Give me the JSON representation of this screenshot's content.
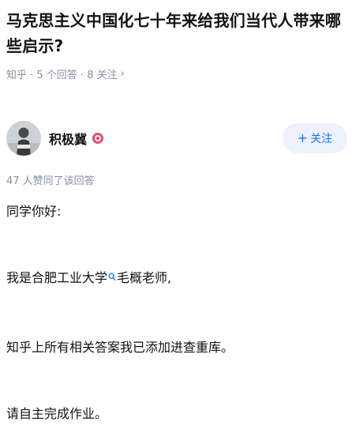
{
  "question": {
    "title": "马克思主义中国化七十年来给我们当代人带来哪些启示?",
    "meta": "知乎 · 5 个回答 · 8 关注",
    "meta_chevron": "›"
  },
  "author": {
    "name": "积极冀",
    "avatar_icon": "avatar-photo",
    "badge_icon": "badge-icon",
    "follow_plus": "+",
    "follow_label": "关注"
  },
  "answer": {
    "votes": "47 人赞同了该回答",
    "paragraphs": {
      "p1": "同学你好:",
      "p2_before": "我是合肥工业大学",
      "p2_after": "毛概老师,",
      "p3": "知乎上所有相关答案我已添加进查重库。",
      "p4": "请自主完成作业。"
    },
    "inline_search_icon": "search-icon"
  },
  "colors": {
    "accent": "#1772f6",
    "accent_bg": "#ecf1fb",
    "meta_gray": "#8590a6",
    "badge_red": "#e0506a"
  }
}
